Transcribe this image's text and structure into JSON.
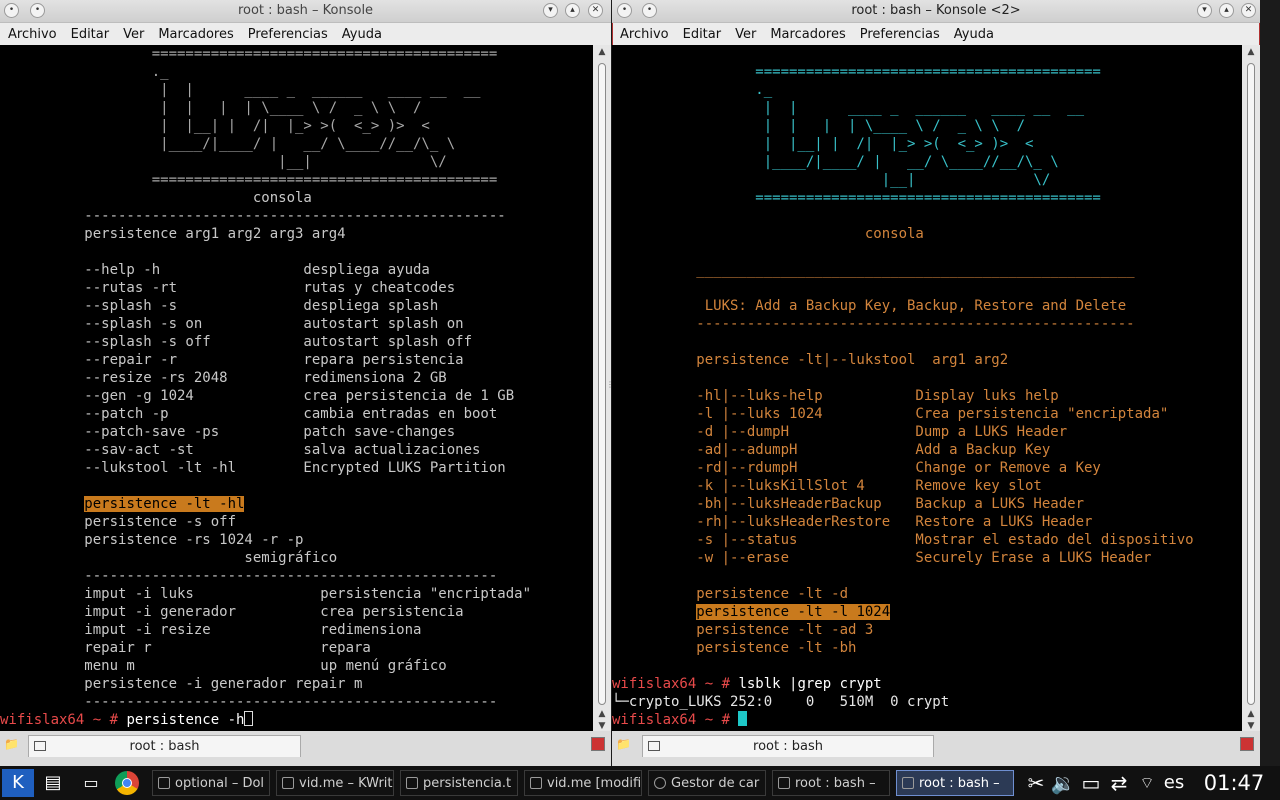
{
  "left_window": {
    "title": "root : bash – Konsole",
    "menu": [
      "Archivo",
      "Editar",
      "Ver",
      "Marcadores",
      "Preferencias",
      "Ayuda"
    ],
    "tab_label": "root : bash",
    "lines": [
      "                  =========================================",
      "                  ._",
      "                   |  |      ____ _  ______   ____ __  __",
      "                   |  |   |  | \\____ \\ /  _ \\ \\  /",
      "                   |  |__| |  /|  |_> >(  <_> )>  <",
      "                   |____/|____/ |   __/ \\____//__/\\_ \\",
      "                                 |__|              \\/",
      "                  =========================================",
      "                              consola",
      "          --------------------------------------------------",
      "          persistence arg1 arg2 arg3 arg4",
      "",
      "          --help -h                 despliega ayuda",
      "          --rutas -rt               rutas y cheatcodes",
      "          --splash -s               despliega splash",
      "          --splash -s on            autostart splash on",
      "          --splash -s off           autostart splash off",
      "          --repair -r               repara persistencia",
      "          --resize -rs 2048         redimensiona 2 GB",
      "          --gen -g 1024             crea persistencia de 1 GB",
      "          --patch -p                cambia entradas en boot",
      "          --patch-save -ps          patch save-changes",
      "          --sav-act -st             salva actualizaciones",
      "          --lukstool -lt -hl        Encrypted LUKS Partition",
      "",
      "          persistence -lt -hl",
      "          persistence -s off",
      "          persistence -rs 1024 -r -p",
      "                             semigráfico",
      "          -------------------------------------------------",
      "          imput -i luks               persistencia \"encriptada\"",
      "          imput -i generador          crea persistencia",
      "          imput -i resize             redimensiona",
      "          repair r                    repara",
      "          menu m                      up menú gráfico",
      "          persistence -i generador repair m",
      "          -------------------------------------------------",
      "wifislax64 ~ # persistence -h"
    ]
  },
  "right_window": {
    "title": "root : bash – Konsole <2>",
    "menu": [
      "Archivo",
      "Editar",
      "Ver",
      "Marcadores",
      "Preferencias",
      "Ayuda"
    ],
    "tab_label": "root : bash",
    "lines": [
      "",
      "                 =========================================",
      "                 ._",
      "                  |  |      ____ _  ______   ____ __  __",
      "                  |  |   |  | \\____ \\ /  _ \\ \\  /",
      "                  |  |__| |  /|  |_> >(  <_> )>  <",
      "                  |____/|____/ |   __/ \\____//__/\\_ \\",
      "                                |__|              \\/",
      "                 =========================================",
      "",
      "                              consola",
      "",
      "          ____________________________________________________",
      "",
      "           LUKS: Add a Backup Key, Backup, Restore and Delete",
      "          ----------------------------------------------------",
      "",
      "          persistence -lt|--lukstool  arg1 arg2",
      "",
      "          -hl|--luks-help           Display luks help",
      "          -l |--luks 1024           Crea persistencia \"encriptada\"",
      "          -d |--dumpH               Dump a LUKS Header",
      "          -ad|--adumpH              Add a Backup Key",
      "          -rd|--rdumpH              Change or Remove a Key",
      "          -k |--luksKillSlot 4      Remove key slot",
      "          -bh|--luksHeaderBackup    Backup a LUKS Header",
      "          -rh|--luksHeaderRestore   Restore a LUKS Header",
      "          -s |--status              Mostrar el estado del dispositivo",
      "          -w |--erase               Securely Erase a LUKS Header",
      "",
      "          persistence -lt -d",
      "          persistence -lt -l 1024",
      "          persistence -lt -ad 3",
      "          persistence -lt -bh",
      "",
      "wifislax64 ~ # lsblk |grep crypt",
      "└─crypto_LUKS 252:0    0   510M  0 crypt",
      "wifislax64 ~ # "
    ]
  },
  "taskbar": {
    "items": [
      "optional – Dol",
      "vid.me – KWrit",
      "persistencia.t",
      "vid.me [modifi",
      "Gestor de car",
      "root : bash –",
      "root : bash –"
    ],
    "keyboard_layout": "es",
    "clock": "01:47"
  },
  "colors": {
    "left_text": "#c8c8c8",
    "right_text": "#d2843c",
    "right_logo": "#38c0c8",
    "prompt": "#e84a4a",
    "highlight_bg": "#c97a1d",
    "cursor": "#1ec8c8"
  }
}
